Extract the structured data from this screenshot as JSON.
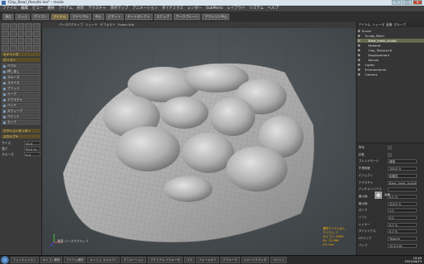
{
  "window": {
    "title": "Clay_Bowl_Results.lxo* - modo",
    "min": "—",
    "max": "□",
    "close": "✕"
  },
  "menu": [
    "ファイル",
    "編集",
    "ビュー",
    "選択",
    "アイテム",
    "形状",
    "テクスチャ",
    "頂点マップ",
    "アニメーション",
    "ダイナミクス",
    "レンダー",
    "SubMerlo",
    "レイアウト",
    "システム",
    "ヘルプ"
  ],
  "toolbar": {
    "buttons": [
      "頂点",
      "エッジ",
      "ポリゴン",
      "アイテム",
      "マテリアル",
      "中心",
      "ピボット",
      "オートセレクト",
      "スナップ",
      "ワークプレーン",
      "アクション中心"
    ],
    "selected_index": 3
  },
  "left_panel": {
    "icon_rows": 4,
    "header1": "モデリング",
    "tools_header": "ポリゴン",
    "tools": [
      "ベベル",
      "押し出し",
      "スムーズ",
      "スライス",
      "ブリッジ",
      "ループ",
      "テクスチャ",
      "ベンド",
      "スウィープ",
      "ペイント",
      "カーブ"
    ],
    "section2": "アクションセンター",
    "section3": "スカルプト",
    "fields": [
      {
        "label": "サイズ",
        "value": "50.0 mm"
      },
      {
        "label": "強さ",
        "value": "50.0 %"
      },
      {
        "label": "スムーズ",
        "value": "0.0"
      }
    ]
  },
  "viewport": {
    "tabs": [
      "パースペクティブ",
      "シェード",
      "デフォルト",
      "Frame Info"
    ],
    "view_label": "最適 パースペクティブ",
    "info_lines": [
      "選択アイテムなし",
      "アイテム: 1",
      "ポリゴン: 6400",
      "GL: 12,996",
      "0.0 mm"
    ]
  },
  "right_panel": {
    "tabs": [
      "アイテム",
      "シェーダ",
      "画像",
      "グループ"
    ],
    "tree": [
      {
        "label": "Scene",
        "indent": 0,
        "sel": false
      },
      {
        "label": "Sculpt_Mesh",
        "indent": 1,
        "sel": false
      },
      {
        "label": "Base_mesh_sculpt",
        "indent": 2,
        "sel": true
      },
      {
        "label": "Material",
        "indent": 2,
        "sel": false
      },
      {
        "label": "Clay_Texture.tif",
        "indent": 2,
        "sel": false
      },
      {
        "label": "Displacement",
        "indent": 2,
        "sel": false
      },
      {
        "label": "Decals",
        "indent": 2,
        "sel": false
      },
      {
        "label": "Lights",
        "indent": 1,
        "sel": false
      },
      {
        "label": "Environments",
        "indent": 1,
        "sel": false
      },
      {
        "label": "Camera",
        "indent": 1,
        "sel": false
      }
    ],
    "props": [
      {
        "label": "有効",
        "value": "",
        "chk": true
      },
      {
        "label": "反転",
        "value": "",
        "chk": true
      },
      {
        "label": "ブレンドモード",
        "value": "通常"
      },
      {
        "label": "不透明度",
        "value": "100.0 %"
      },
      {
        "label": "エフェクト",
        "value": "拡散色"
      },
      {
        "label": "テクスチャ",
        "value": "Base_mesh_sculpt"
      },
      {
        "label": "アンチエイリアス",
        "value": ""
      },
      {
        "label": "最小値",
        "value": "0.0 %"
      },
      {
        "label": "最大値",
        "value": "100.0 %"
      },
      {
        "label": "ガンマ",
        "value": "1.0"
      },
      {
        "label": "ソフト",
        "value": "0.0"
      },
      {
        "label": "レイヤー",
        "value": "0.0 %"
      },
      {
        "label": "ダイナミクス",
        "value": "0.0 %"
      },
      {
        "label": "UVマップ",
        "value": "Texture"
      },
      {
        "label": "バンプ",
        "value": "10.0 mm"
      }
    ],
    "swatch_label": "画像"
  },
  "status_items": [
    "",
    "フェイスレジスト",
    "ポリゴン選択",
    "アイテム選択",
    "メッシュ スカルプト",
    "アニメーション",
    "マテリアル パラメータ",
    "パス",
    "フォールオフ",
    "デフォーマ",
    "イメージエディタ",
    "ペイント"
  ],
  "clock": {
    "time": "10:49",
    "date": "2011/04/13"
  },
  "colors": {
    "accent": "#ffb000",
    "selected": "#6a6a50",
    "mesh": "#b4b4b4"
  }
}
